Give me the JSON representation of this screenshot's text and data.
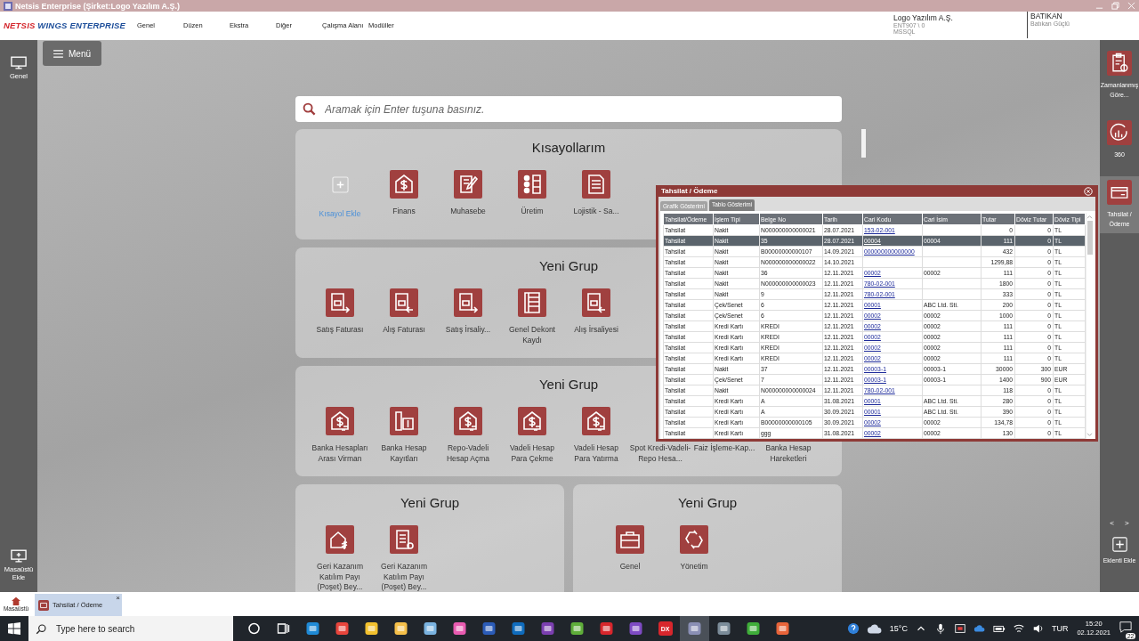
{
  "window": {
    "title": "Netsis Enterprise (Şirket:Logo Yazılım A.Ş.)"
  },
  "header": {
    "logo": {
      "brand": "NETSIS",
      "product": "WINGS ENTERPRISE"
    },
    "menu": [
      "Genel",
      "Düzen",
      "Ekstra",
      "Diğer",
      "Çalışma Alanı",
      "Modüller"
    ],
    "company": {
      "name": "Logo Yazılım A.Ş.",
      "database": "ENT907 \\ 0",
      "server": "MSSQL"
    },
    "user": {
      "code": "BATIKAN",
      "name": "Batıkan Güçlü"
    }
  },
  "left_sidebar": {
    "top": {
      "label": "Genel"
    },
    "bottom": {
      "label": "Masaüstü Ekle"
    }
  },
  "menu_button": {
    "label": "Menü"
  },
  "search": {
    "placeholder": "Aramak için Enter tuşuna basınız."
  },
  "groups": [
    {
      "title": "Kısayollarım",
      "items": [
        {
          "label": "Kısayol Ekle",
          "kind": "add"
        },
        {
          "label": "Finans",
          "kind": "dollar"
        },
        {
          "label": "Muhasebe",
          "kind": "edit"
        },
        {
          "label": "Üretim",
          "kind": "checklist"
        },
        {
          "label": "Lojistik - Sa...",
          "kind": "sheet"
        }
      ]
    },
    {
      "title": "Yeni Grup",
      "items": [
        {
          "label": "Satış Faturası",
          "kind": "doc-out"
        },
        {
          "label": "Alış Faturası",
          "kind": "doc-in"
        },
        {
          "label": "Satış İrsaliy...",
          "kind": "doc-out"
        },
        {
          "label": "Genel Dekont Kaydı",
          "kind": "ledger"
        },
        {
          "label": "Alış İrsaliyesi",
          "kind": "doc-in"
        }
      ]
    },
    {
      "title": "Yeni Grup",
      "items": [
        {
          "label": "Banka Hesapları Arası Virman",
          "kind": "transfer"
        },
        {
          "label": "Banka Hesap Kayıtları",
          "kind": "files"
        },
        {
          "label": "Repo-Vadeli Hesap Açma",
          "kind": "transfer"
        },
        {
          "label": "Vadeli Hesap Para Çekme",
          "kind": "transfer"
        },
        {
          "label": "Vadeli Hesap Para Yatırma",
          "kind": "transfer"
        },
        {
          "label": "Spot Kredi-Vadeli-Repo Hesa...",
          "kind": "hidden"
        },
        {
          "label": "Faiz İşleme-Kap...",
          "kind": "hidden"
        },
        {
          "label": "Banka Hesap Hareketleri",
          "kind": "hidden"
        }
      ]
    },
    {
      "title": "Yeni Grup",
      "items": [
        {
          "label": "Geri Kazanım Katılım Payı (Poşet) Bey...",
          "kind": "lira"
        },
        {
          "label": "Geri Kazanım Katılım Payı (Poşet) Bey...",
          "kind": "list"
        }
      ]
    },
    {
      "title": "Yeni Grup",
      "items": [
        {
          "label": "Genel",
          "kind": "toolbox"
        },
        {
          "label": "Yönetim",
          "kind": "recycle"
        }
      ]
    }
  ],
  "right_sidebar": [
    {
      "label": "Zamanlanmış Göre...",
      "kind": "clipboard",
      "selected": false
    },
    {
      "label": "360",
      "kind": "chart",
      "selected": false
    },
    {
      "label": "Tahsilat / Ödeme",
      "kind": "card",
      "selected": true
    }
  ],
  "right_nav": {
    "prev": "<",
    "next": ">",
    "add": "Eklenti Ekle"
  },
  "popup": {
    "title": "Tahsilat / Ödeme",
    "tabs": [
      {
        "label": "Grafik Gösterimi",
        "selected": false
      },
      {
        "label": "Tablo Gösterimi",
        "selected": true
      }
    ],
    "columns": [
      "Tahsilat/Ödeme",
      "İşlem Tipi",
      "Belge No",
      "Tarih",
      "Cari Kodu",
      "Cari İsim",
      "Tutar",
      "Döviz Tutar",
      "Döviz Tipi"
    ],
    "rows": [
      {
        "type": "Tahsilat",
        "method": "Nakit",
        "doc": "N000000000000021",
        "date": "28.07.2021",
        "code": "153-02-001",
        "amount": "0",
        "fx_amount": "0",
        "fx_type": "TL",
        "selected": false
      },
      {
        "type": "Tahsilat",
        "method": "Nakit",
        "doc": "35",
        "date": "28.07.2021",
        "code": "00004",
        "name": "00004",
        "amount": "111",
        "fx_amount": "0",
        "fx_type": "TL",
        "selected": true
      },
      {
        "type": "Tahsilat",
        "method": "Nakit",
        "doc": "B00000000000107",
        "date": "14.09.2021",
        "code": "000000000000000",
        "amount": "432",
        "fx_amount": "0",
        "fx_type": "TL",
        "selected": false
      },
      {
        "type": "Tahsilat",
        "method": "Nakit",
        "doc": "N000000000000022",
        "date": "14.10.2021",
        "amount": "1299,88",
        "fx_amount": "0",
        "fx_type": "TL",
        "selected": false
      },
      {
        "type": "Tahsilat",
        "method": "Nakit",
        "doc": "36",
        "date": "12.11.2021",
        "code": "00002",
        "name": "00002",
        "amount": "111",
        "fx_amount": "0",
        "fx_type": "TL",
        "selected": false
      },
      {
        "type": "Tahsilat",
        "method": "Nakit",
        "doc": "N000000000000023",
        "date": "12.11.2021",
        "code": "780-02-001",
        "amount": "1800",
        "fx_amount": "0",
        "fx_type": "TL",
        "selected": false
      },
      {
        "type": "Tahsilat",
        "method": "Nakit",
        "doc": "9",
        "date": "12.11.2021",
        "code": "780-02-001",
        "amount": "333",
        "fx_amount": "0",
        "fx_type": "TL",
        "selected": false
      },
      {
        "type": "Tahsilat",
        "method": "Çek/Senet",
        "doc": "6",
        "date": "12.11.2021",
        "code": "00001",
        "name": "ABC Ltd. Sti.",
        "amount": "200",
        "fx_amount": "0",
        "fx_type": "TL",
        "selected": false
      },
      {
        "type": "Tahsilat",
        "method": "Çek/Senet",
        "doc": "6",
        "date": "12.11.2021",
        "code": "00002",
        "name": "00002",
        "amount": "1000",
        "fx_amount": "0",
        "fx_type": "TL",
        "selected": false
      },
      {
        "type": "Tahsilat",
        "method": "Kredi Kartı",
        "doc": "KREDI",
        "date": "12.11.2021",
        "code": "00002",
        "name": "00002",
        "amount": "111",
        "fx_amount": "0",
        "fx_type": "TL",
        "selected": false
      },
      {
        "type": "Tahsilat",
        "method": "Kredi Kartı",
        "doc": "KREDI",
        "date": "12.11.2021",
        "code": "00002",
        "name": "00002",
        "amount": "111",
        "fx_amount": "0",
        "fx_type": "TL",
        "selected": false
      },
      {
        "type": "Tahsilat",
        "method": "Kredi Kartı",
        "doc": "KREDI",
        "date": "12.11.2021",
        "code": "00002",
        "name": "00002",
        "amount": "111",
        "fx_amount": "0",
        "fx_type": "TL",
        "selected": false
      },
      {
        "type": "Tahsilat",
        "method": "Kredi Kartı",
        "doc": "KREDI",
        "date": "12.11.2021",
        "code": "00002",
        "name": "00002",
        "amount": "111",
        "fx_amount": "0",
        "fx_type": "TL",
        "selected": false
      },
      {
        "type": "Tahsilat",
        "method": "Nakit",
        "doc": "37",
        "date": "12.11.2021",
        "code": "00003-1",
        "name": "00003-1",
        "amount": "30000",
        "fx_amount": "300",
        "fx_type": "EUR",
        "selected": false
      },
      {
        "type": "Tahsilat",
        "method": "Çek/Senet",
        "doc": "7",
        "date": "12.11.2021",
        "code": "00003-1",
        "name": "00003-1",
        "amount": "1400",
        "fx_amount": "900",
        "fx_type": "EUR",
        "selected": false
      },
      {
        "type": "Tahsilat",
        "method": "Nakit",
        "doc": "N000000000000024",
        "date": "12.11.2021",
        "code": "780-02-001",
        "amount": "118",
        "fx_amount": "0",
        "fx_type": "TL",
        "selected": false
      },
      {
        "type": "Tahsilat",
        "method": "Kredi Kartı",
        "doc": "A",
        "date": "31.08.2021",
        "code": "00001",
        "name": "ABC Ltd. Sti.",
        "amount": "280",
        "fx_amount": "0",
        "fx_type": "TL",
        "selected": false
      },
      {
        "type": "Tahsilat",
        "method": "Kredi Kartı",
        "doc": "A",
        "date": "30.09.2021",
        "code": "00001",
        "name": "ABC Ltd. Sti.",
        "amount": "390",
        "fx_amount": "0",
        "fx_type": "TL",
        "selected": false
      },
      {
        "type": "Tahsilat",
        "method": "Kredi Kartı",
        "doc": "B00000000000105",
        "date": "30.09.2021",
        "code": "00002",
        "name": "00002",
        "amount": "134,78",
        "fx_amount": "0",
        "fx_type": "TL",
        "selected": false
      },
      {
        "type": "Tahsilat",
        "method": "Kredi Kartı",
        "doc": "ggg",
        "date": "31.08.2021",
        "code": "00002",
        "name": "00002",
        "amount": "130",
        "fx_amount": "0",
        "fx_type": "TL",
        "selected": false
      }
    ]
  },
  "doc_tabs": {
    "home": "Masaüstü",
    "tabs": [
      {
        "label": "Tahsilat / Ödeme",
        "close": "×",
        "selected": true
      }
    ]
  },
  "taskbar": {
    "search": {
      "placeholder": "Type here to search"
    },
    "app_badge": "DX",
    "weather": "15°C",
    "language": "TUR",
    "time": "15:20",
    "date": "02.12.2021",
    "notifications": "22"
  }
}
